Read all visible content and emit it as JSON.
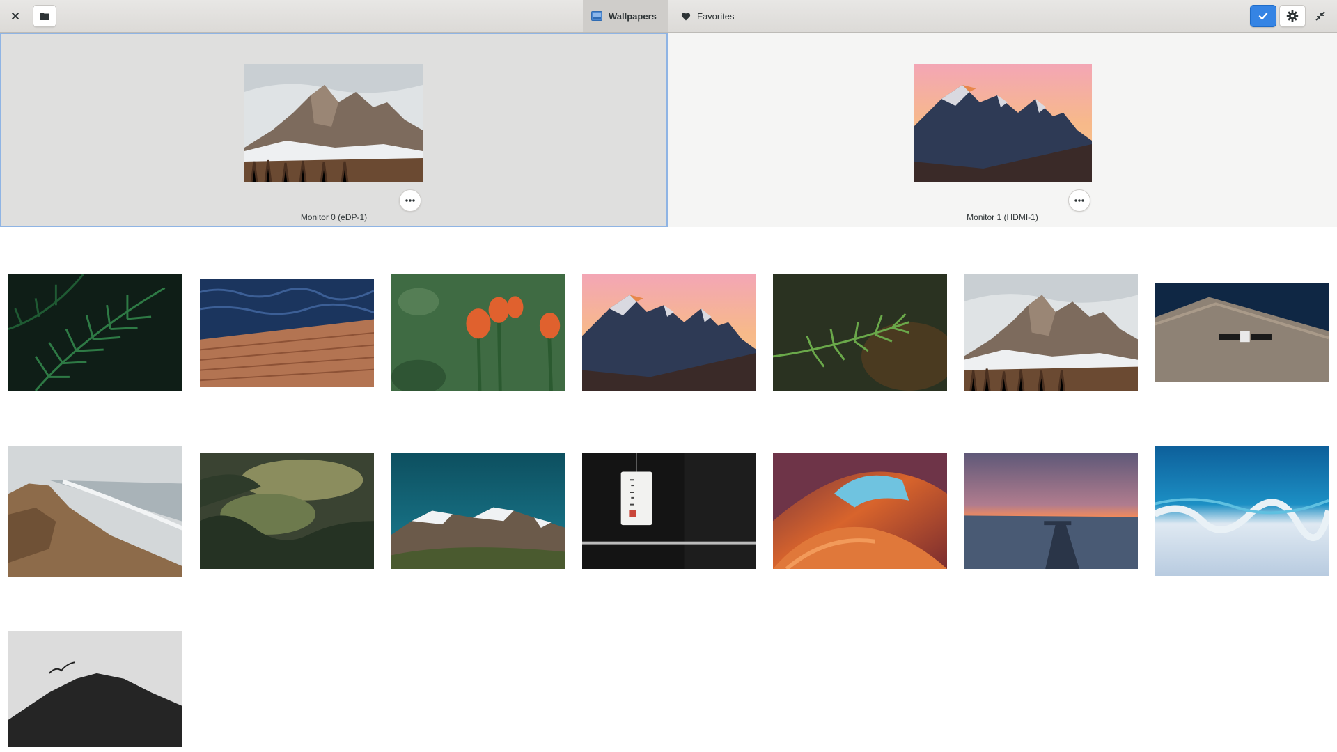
{
  "header": {
    "tabs": [
      {
        "label": "Wallpapers",
        "icon": "image-icon",
        "active": true
      },
      {
        "label": "Favorites",
        "icon": "heart-icon",
        "active": false
      }
    ],
    "buttons": {
      "close": "close-icon",
      "open_folder": "folder-icon",
      "apply": "checkmark-icon",
      "settings": "gear-icon",
      "restore": "restore-window-icon"
    },
    "accent_color": "#3584e4"
  },
  "monitors": [
    {
      "label": "Monitor 0 (eDP-1)",
      "wallpaper": "snowy-dolomites",
      "selected": true
    },
    {
      "label": "Monitor 1 (HDMI-1)",
      "wallpaper": "sunset-mountains",
      "selected": false
    }
  ],
  "wallpapers": [
    {
      "name": "fern"
    },
    {
      "name": "dock-on-water"
    },
    {
      "name": "tulips"
    },
    {
      "name": "sunset-mountains"
    },
    {
      "name": "pine-branch"
    },
    {
      "name": "snowy-dolomites"
    },
    {
      "name": "satellite-over-earth"
    },
    {
      "name": "beach-cliff"
    },
    {
      "name": "misty-forest"
    },
    {
      "name": "snowy-peaks-teal-sky"
    },
    {
      "name": "paper-lantern"
    },
    {
      "name": "antelope-canyon"
    },
    {
      "name": "pier-at-dusk"
    },
    {
      "name": "ocean-waves-aerial"
    },
    {
      "name": "bird-over-hill"
    }
  ]
}
